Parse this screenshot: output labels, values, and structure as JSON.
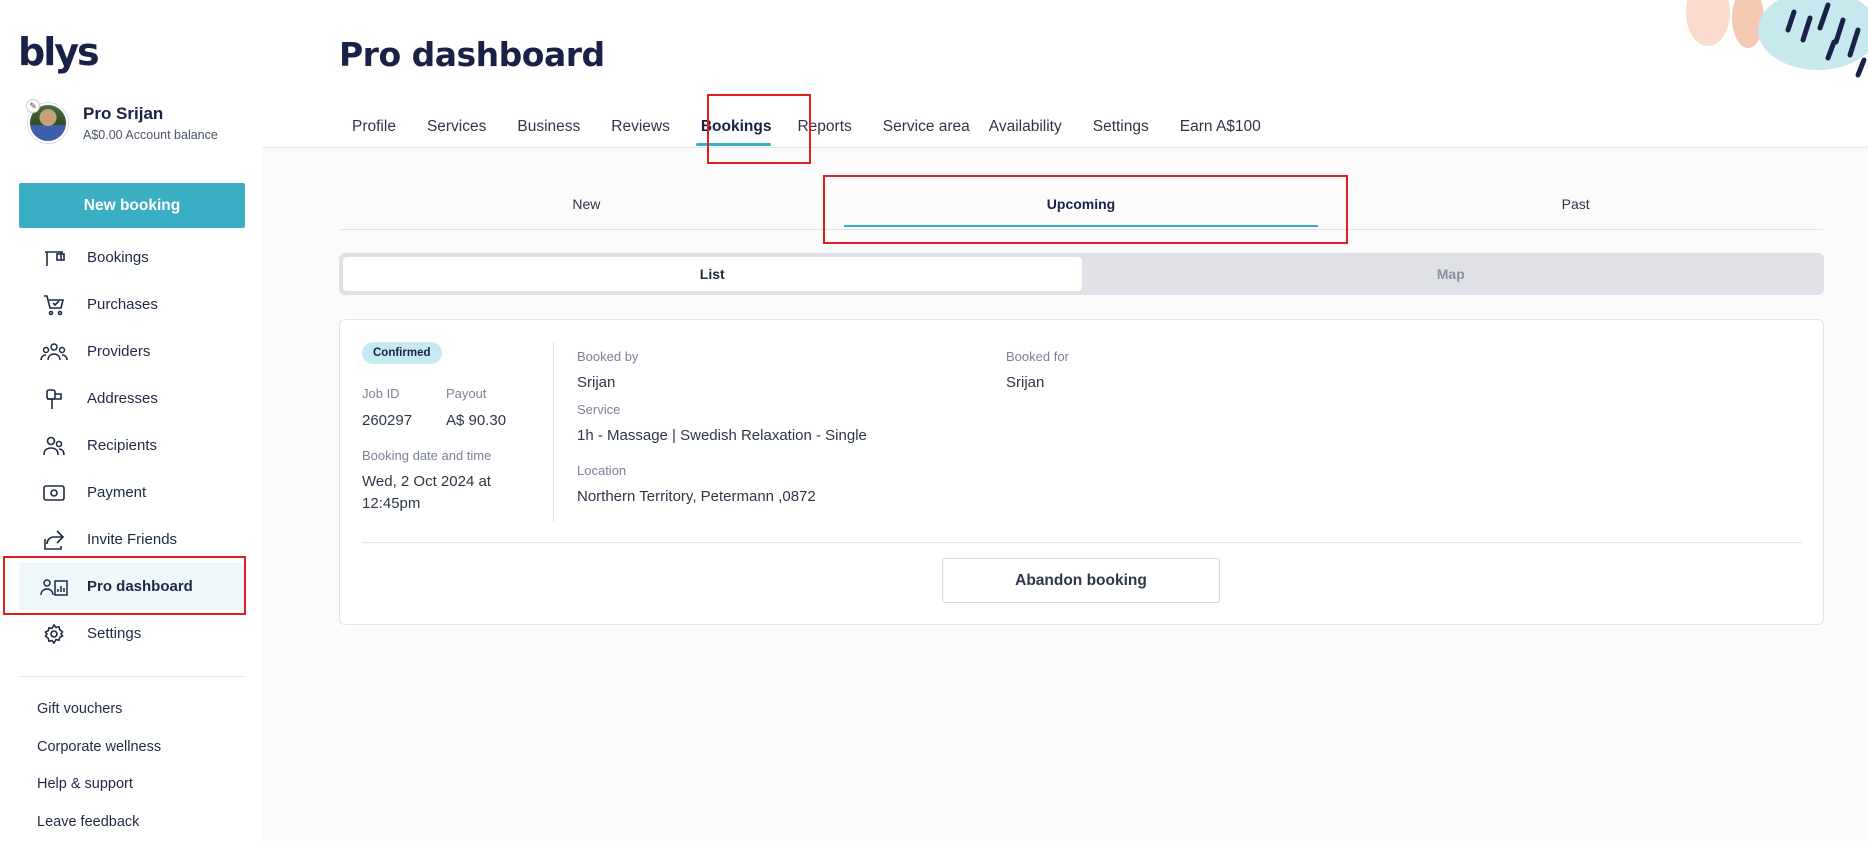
{
  "app": {
    "logo": "blys"
  },
  "profile": {
    "name": "Pro Srijan",
    "balance": "A$0.00 Account balance"
  },
  "sidebar": {
    "new_booking": "New booking",
    "items": [
      {
        "label": "Bookings",
        "icon": "bookings-icon"
      },
      {
        "label": "Purchases",
        "icon": "cart-icon"
      },
      {
        "label": "Providers",
        "icon": "providers-icon"
      },
      {
        "label": "Addresses",
        "icon": "mailbox-icon"
      },
      {
        "label": "Recipients",
        "icon": "recipients-icon"
      },
      {
        "label": "Payment",
        "icon": "payment-icon"
      },
      {
        "label": "Invite Friends",
        "icon": "share-icon"
      },
      {
        "label": "Pro dashboard",
        "icon": "pro-dashboard-icon"
      },
      {
        "label": "Settings",
        "icon": "gear-icon"
      }
    ],
    "footer": [
      "Gift vouchers",
      "Corporate wellness",
      "Help & support",
      "Leave feedback"
    ]
  },
  "header": {
    "title": "Pro dashboard"
  },
  "tabs": [
    "Profile",
    "Services",
    "Business",
    "Reviews",
    "Bookings",
    "Reports",
    "Service area",
    "Availability",
    "Settings",
    "Earn A$100"
  ],
  "subtabs": [
    "New",
    "Upcoming",
    "Past"
  ],
  "view_toggle": [
    "List",
    "Map"
  ],
  "booking": {
    "status": "Confirmed",
    "job_id_label": "Job ID",
    "job_id": "260297",
    "payout_label": "Payout",
    "payout": "A$ 90.30",
    "date_label": "Booking date and time",
    "date_line1": "Wed, 2 Oct 2024 at",
    "date_line2": "12:45pm",
    "booked_by_label": "Booked by",
    "booked_by": "Srijan",
    "booked_for_label": "Booked for",
    "booked_for": "Srijan",
    "service_label": "Service",
    "service": "1h - Massage | Swedish Relaxation - Single",
    "location_label": "Location",
    "location": "Northern Territory, Petermann ,0872",
    "abandon": "Abandon booking"
  },
  "colors": {
    "accent": "#3aafc4",
    "highlight": "#e02020",
    "navy": "#1a2147"
  }
}
